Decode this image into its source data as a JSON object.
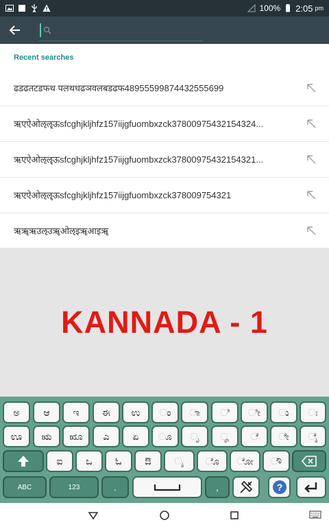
{
  "status_bar": {
    "battery": "100%",
    "time": "2:05",
    "ampm": "pm"
  },
  "search": {
    "placeholder": ""
  },
  "recent": {
    "header": "Recent searches",
    "items": [
      "ढडढतटडफथ पलथधढञवलबडढफ48955599874432555699",
      "ऋएऐओऌॡऊsfcghjkljhfz157iijgfuombxzck37800975432154324...",
      "ऋएऐओऌॡऊsfcghjkljhfz157iijgfuombxzck37800975432154321...",
      "ऋएऐओऌॡऊsfcghjkljhfz157iijgfuombxzck378009754321",
      "ऋॠऋउऌउॠओऌइॠआइॠ"
    ]
  },
  "banner": {
    "text": "KANNADA - 1"
  },
  "keyboard": {
    "row1": [
      "ಅ",
      "ಆ",
      "ಇ",
      "ಈ",
      "ಉ",
      "ಂ",
      "ಾ",
      "ಿ",
      "ೀ",
      "ು",
      "ಃ"
    ],
    "row2": [
      "ಊ",
      "ಋ",
      "ೠ",
      "ಎ",
      "ಏ",
      "ೂ",
      "ೃ",
      "ೄ",
      "ೆ",
      "ೇ",
      "ೈ"
    ],
    "row3": [
      "ಐ",
      "ಒ",
      "ಓ",
      "ಔ",
      "ೖ",
      "ೊ",
      "ೋ",
      "ೌ"
    ],
    "abc": "ABC",
    "num": "123",
    "dot": ".",
    "comma": ","
  },
  "colors": {
    "accent": "#1a8f86",
    "banner_text": "#e01b14",
    "keyboard_bg": "#66a290"
  }
}
